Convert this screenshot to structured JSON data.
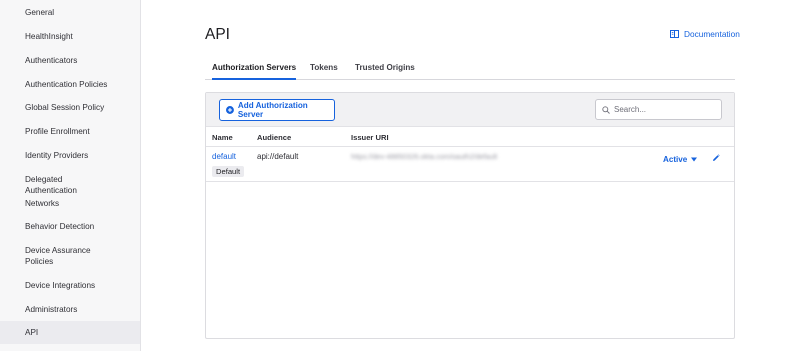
{
  "sidebar": {
    "items": [
      {
        "label": "General"
      },
      {
        "label": "HealthInsight"
      },
      {
        "label": "Authenticators"
      },
      {
        "label": "Authentication Policies"
      },
      {
        "label": "Global Session Policy"
      },
      {
        "label": "Profile Enrollment"
      },
      {
        "label": "Identity Providers"
      },
      {
        "label": "Delegated Authentication"
      },
      {
        "label": "Networks"
      },
      {
        "label": "Behavior Detection"
      },
      {
        "label": "Device Assurance Policies"
      },
      {
        "label": "Device Integrations"
      },
      {
        "label": "Administrators"
      },
      {
        "label": "API"
      }
    ],
    "active": "API"
  },
  "page": {
    "title": "API",
    "documentation_link": "Documentation"
  },
  "tabs": [
    {
      "label": "Authorization Servers",
      "active": true
    },
    {
      "label": "Tokens",
      "active": false
    },
    {
      "label": "Trusted Origins",
      "active": false
    }
  ],
  "toolbar": {
    "add_button": "Add Authorization Server",
    "search_placeholder": "Search..."
  },
  "table": {
    "columns": [
      "Name",
      "Audience",
      "Issuer URI"
    ],
    "rows": [
      {
        "name": "default",
        "badge": "Default",
        "audience": "api://default",
        "issuer_uri": "https://dev-48850326.okta.com/oauth2/default",
        "status": "Active"
      }
    ]
  },
  "colors": {
    "accent": "#1662dd",
    "sidebar_bg": "#f7f7f8",
    "active_item_bg": "#ebebef"
  }
}
